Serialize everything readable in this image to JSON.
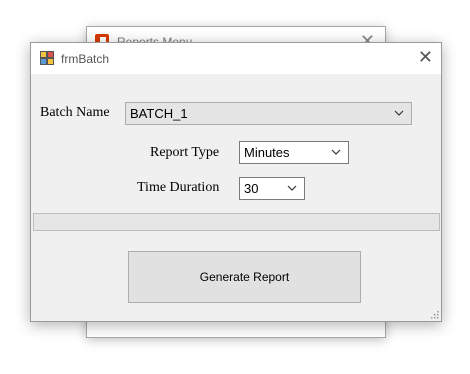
{
  "background_window": {
    "title": "Reports Menu",
    "icon": "office-icon"
  },
  "window": {
    "title": "frmBatch",
    "icon": "form-icon",
    "close": "✕"
  },
  "batch": {
    "label": "Batch Name",
    "value": "BATCH_1"
  },
  "report_type": {
    "label": "Report Type",
    "value": "Minutes"
  },
  "time_duration": {
    "label": "Time Duration",
    "value": "30"
  },
  "progress": {
    "value": 0
  },
  "actions": {
    "generate_label": "Generate Report"
  },
  "colors": {
    "office_accent": "#d83b01",
    "progress_fill": "#06b025"
  }
}
